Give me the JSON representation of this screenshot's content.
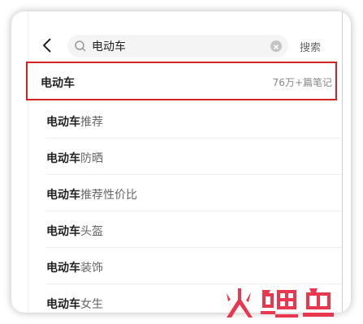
{
  "search": {
    "value": "电动车",
    "button_label": "搜索"
  },
  "top_result": {
    "keyword": "电动车",
    "count": "76万+篇笔记"
  },
  "suggestions": [
    {
      "keyword": "电动车",
      "rest": "推荐"
    },
    {
      "keyword": "电动车",
      "rest": "防晒"
    },
    {
      "keyword": "电动车",
      "rest": "推荐性价比"
    },
    {
      "keyword": "电动车",
      "rest": "头盔"
    },
    {
      "keyword": "电动车",
      "rest": "装饰"
    },
    {
      "keyword": "电动车",
      "rest": "女生"
    }
  ],
  "watermark": {
    "text": "火鲤鱼",
    "color": "#e8374f"
  },
  "colors": {
    "highlight_border": "#d42222",
    "keyword": "#222222",
    "muted": "#888888"
  }
}
